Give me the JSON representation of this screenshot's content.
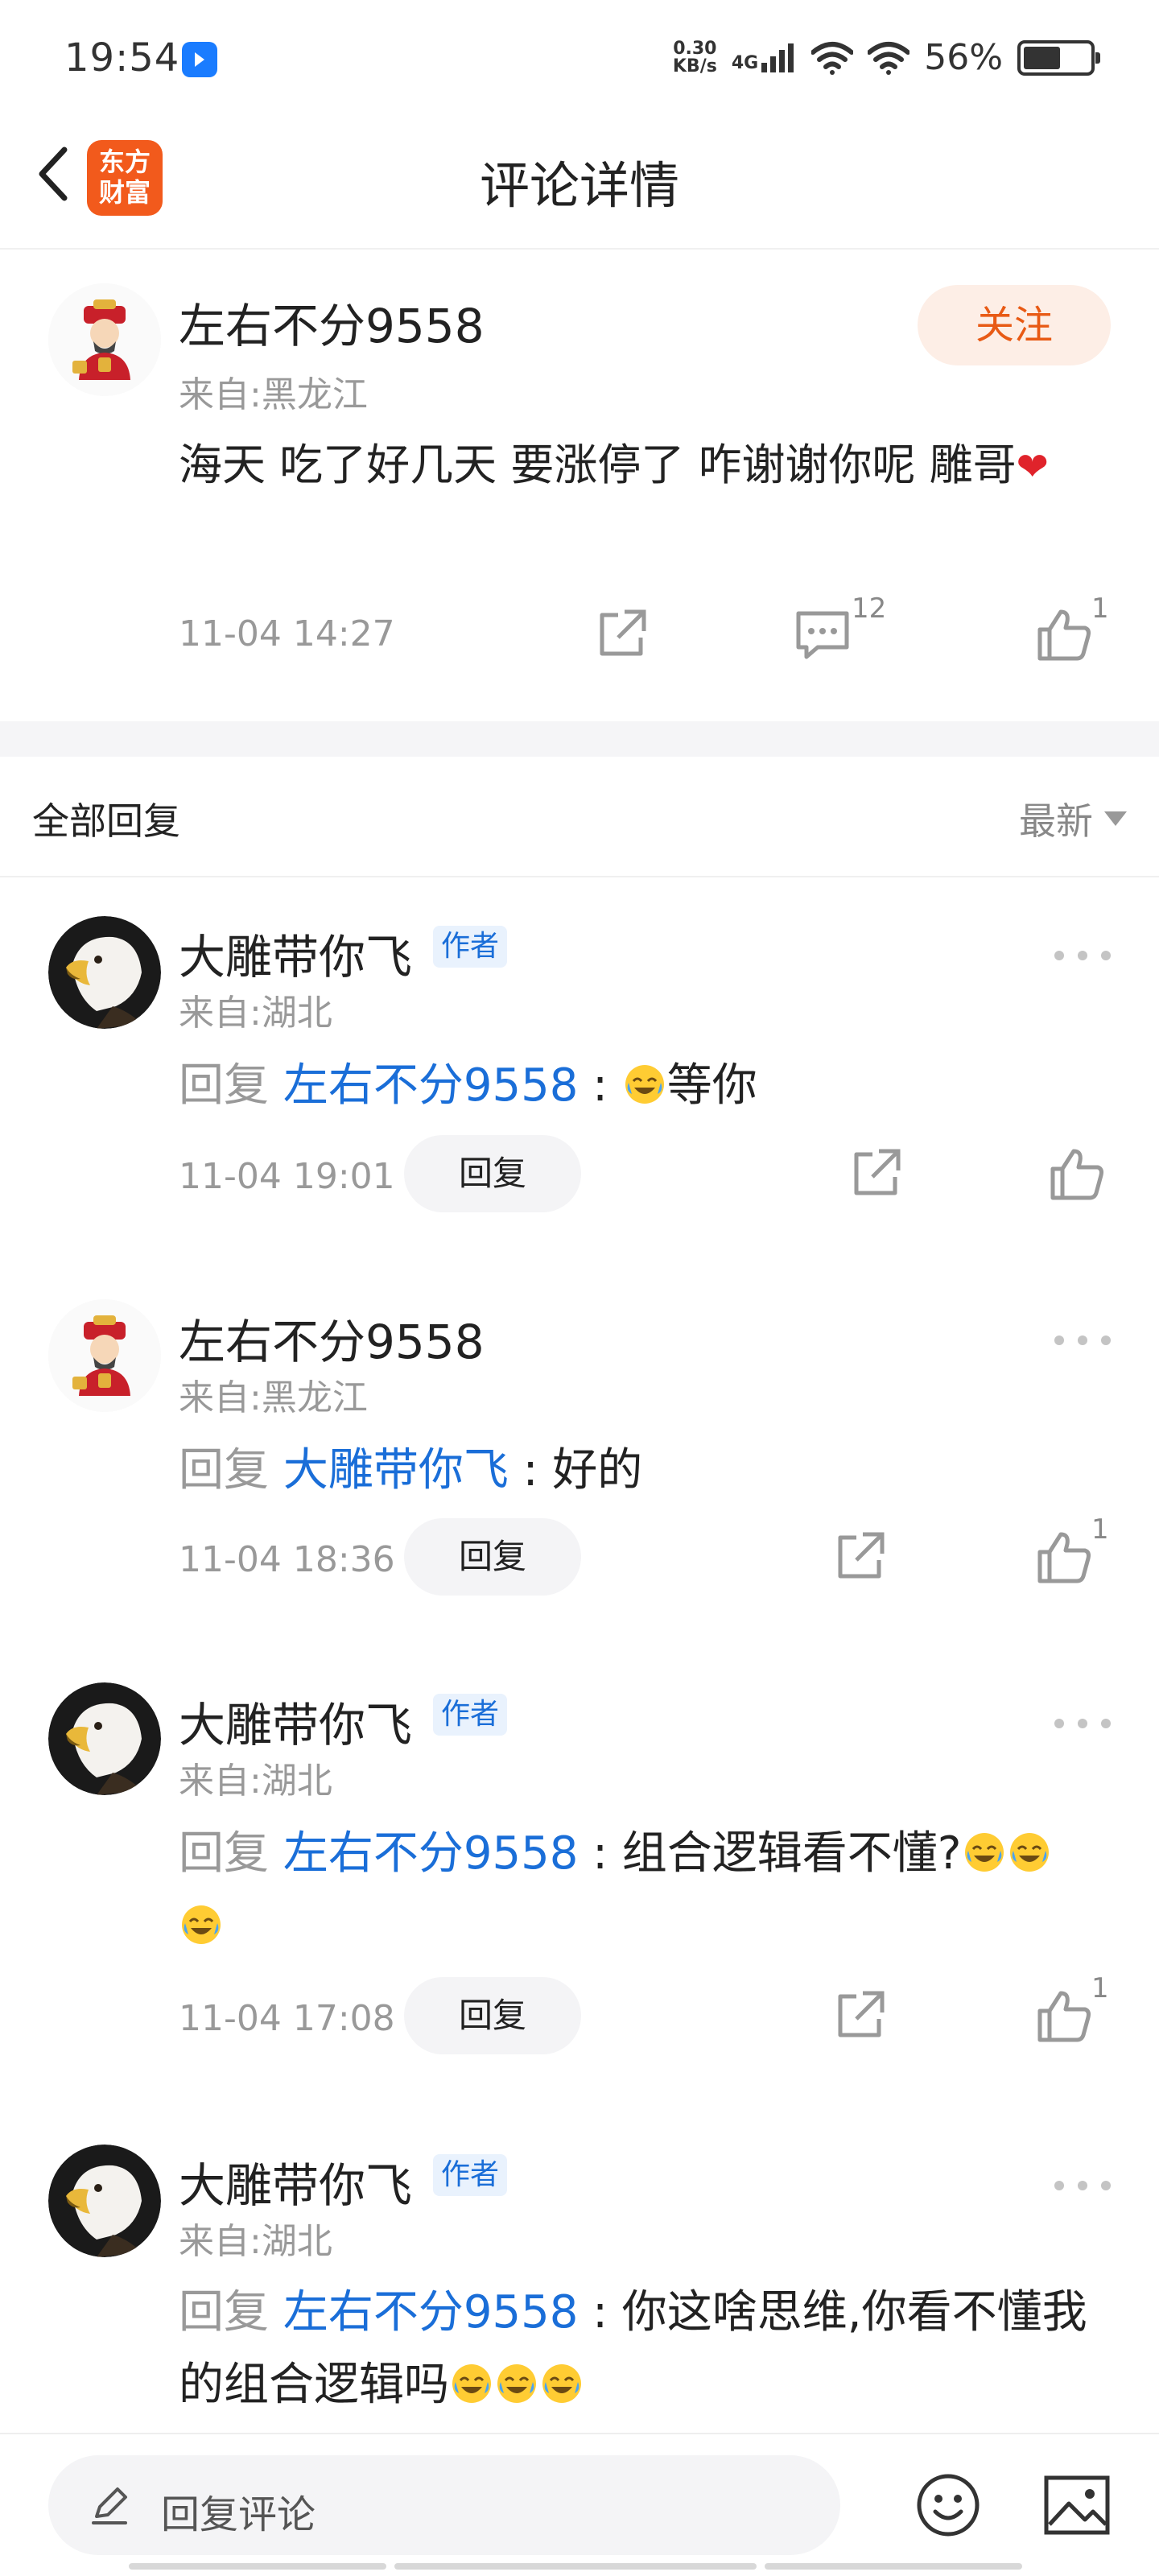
{
  "status_bar": {
    "time": "19:54",
    "net_speed_value": "0.30",
    "net_speed_unit": "KB/s",
    "network": "4G",
    "battery_percent": "56%",
    "battery_level": 0.56
  },
  "nav": {
    "title": "评论详情",
    "logo_line1": "东方",
    "logo_line2": "财富",
    "logo_color": "#f25a1c"
  },
  "main_comment": {
    "username": "左右不分9558",
    "location": "来自:黑龙江",
    "follow_label": "关注",
    "text": "海天 吃了好几天  要涨停了 咋谢谢你呢 雕哥",
    "heart": "❤",
    "time": "11-04 14:27",
    "comment_count": "12",
    "like_count": "1"
  },
  "replies_header": {
    "title": "全部回复",
    "sort_label": "最新"
  },
  "replies": [
    {
      "username": "大雕带你飞",
      "badge": "作者",
      "location": "来自:湖北",
      "prefix": "回复 ",
      "target": "左右不分9558",
      "colon": " : ",
      "text_after": "等你",
      "time": "11-04 19:01",
      "reply_label": "回复",
      "like_count": ""
    },
    {
      "username": "左右不分9558",
      "badge": "",
      "location": "来自:黑龙江",
      "prefix": "回复 ",
      "target": "大雕带你飞",
      "colon": " : ",
      "text_after": "好的",
      "time": "11-04 18:36",
      "reply_label": "回复",
      "like_count": "1"
    },
    {
      "username": "大雕带你飞",
      "badge": "作者",
      "location": "来自:湖北",
      "prefix": "回复 ",
      "target": "左右不分9558",
      "colon": " : ",
      "text_after": "组合逻辑看不懂?",
      "time": "11-04 17:08",
      "reply_label": "回复",
      "like_count": "1"
    },
    {
      "username": "大雕带你飞",
      "badge": "作者",
      "location": "来自:湖北",
      "prefix": "回复 ",
      "target": "左右不分9558",
      "colon": " : ",
      "text_after": "你这啥思维,你看不懂我的组合逻辑吗"
    }
  ],
  "bottom_bar": {
    "input_placeholder": "回复评论"
  },
  "colors": {
    "accent_blue": "#1a6ed8",
    "follow_orange": "#e85a15"
  }
}
